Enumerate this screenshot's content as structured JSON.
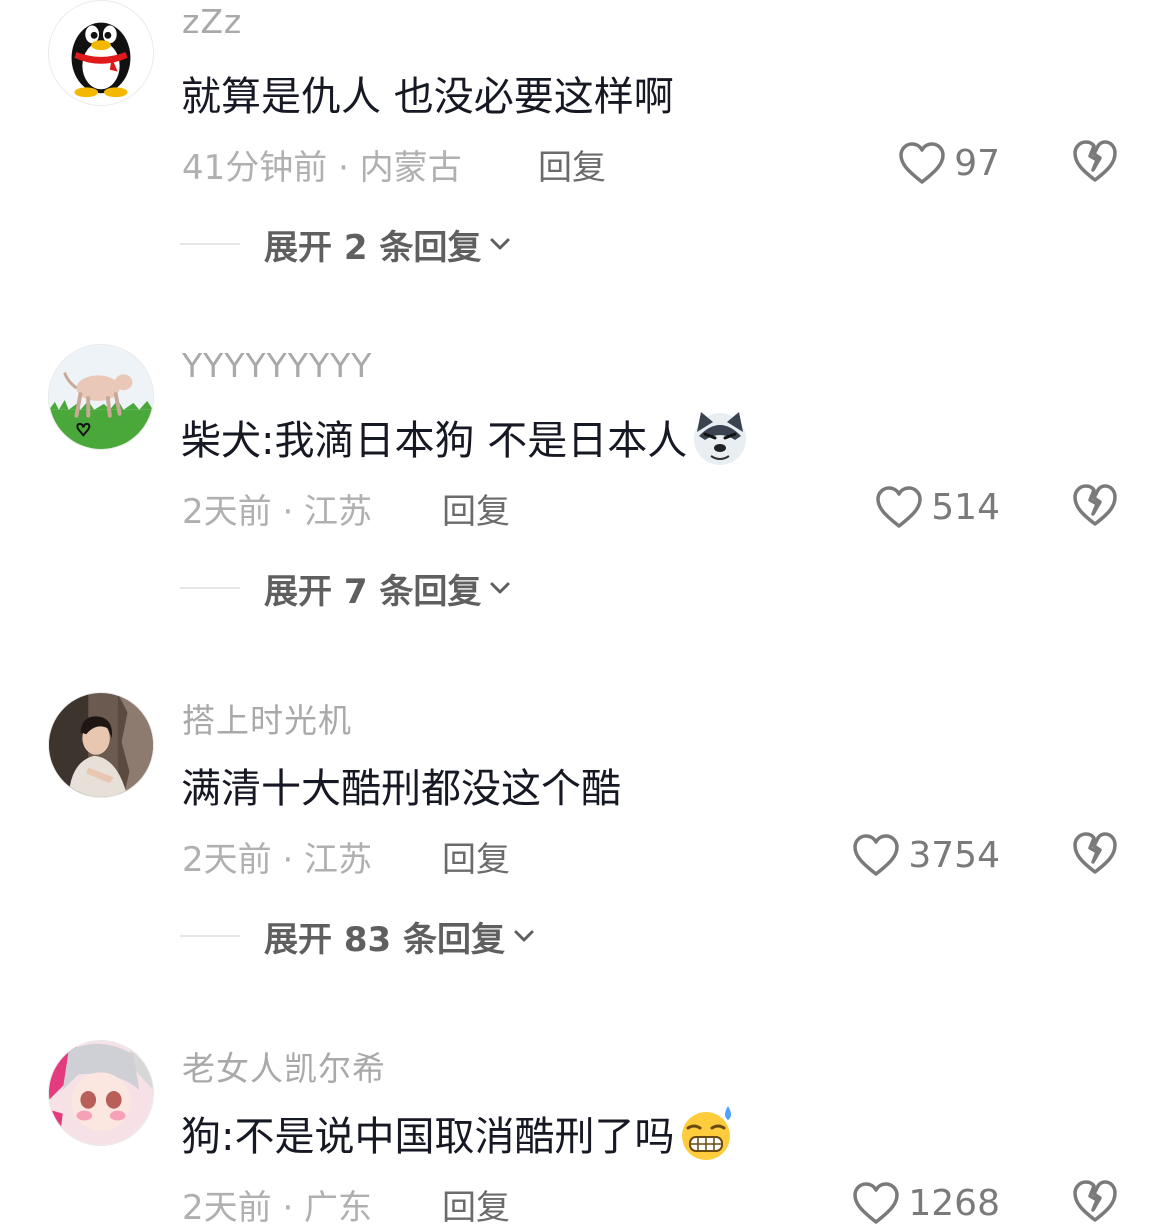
{
  "colors": {
    "username": "#a9a9a9",
    "text": "#161823",
    "meta": "#b0b0b0",
    "reply": "#6b6b6b",
    "like": "#7a7a7a",
    "expand": "#5f5f5f"
  },
  "comments": [
    {
      "username": "zZz",
      "text": "就算是仇人 也没必要这样啊",
      "meta": "41分钟前 · 内蒙古",
      "reply_label": "回复",
      "likes": "97",
      "expand_label": "展开 2 条回复",
      "avatar": "qq-penguin-avatar"
    },
    {
      "username": "YYYYYYYYY",
      "text": "柴犬:我滴日本狗 不是日本人",
      "meta": "2天前 · 江苏",
      "reply_label": "回复",
      "likes": "514",
      "expand_label": "展开 7 条回复",
      "avatar": "dog-drawing-avatar",
      "emoji": "husky-emoji"
    },
    {
      "username": "搭上时光机",
      "text": "满清十大酷刑都没这个酷",
      "meta": "2天前 · 江苏",
      "reply_label": "回复",
      "likes": "3754",
      "expand_label": "展开 83 条回复",
      "avatar": "girl-photo-avatar"
    },
    {
      "username": "老女人凯尔希",
      "text": "狗:不是说中国取消酷刑了吗",
      "meta": "2天前 · 广东",
      "reply_label": "回复",
      "likes": "1268",
      "avatar": "anime-character-avatar",
      "emoji": "grimace-sweat-emoji"
    }
  ]
}
